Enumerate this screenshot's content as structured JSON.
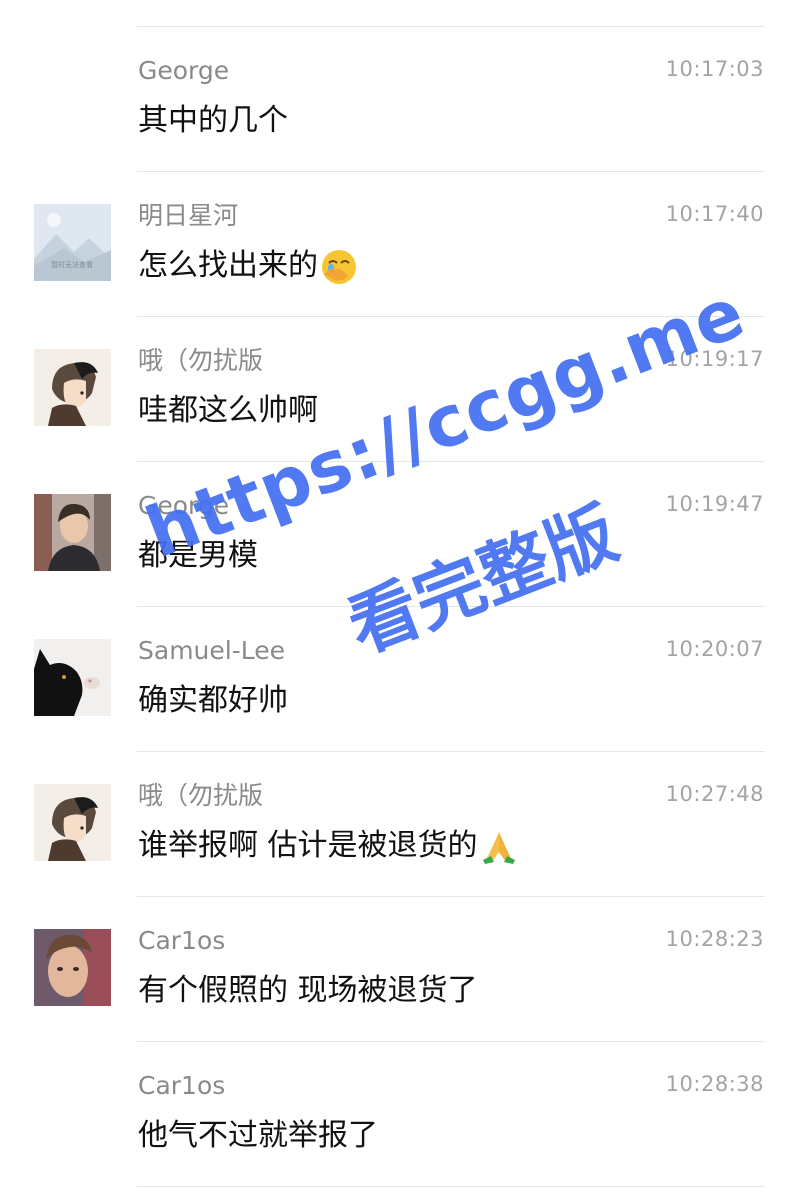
{
  "messages": [
    {
      "sender": "George",
      "time": "10:17:03",
      "text": "其中的几个",
      "avatar": "none",
      "emoji": ""
    },
    {
      "sender": "明日星河",
      "time": "10:17:40",
      "text": "怎么找出来的",
      "avatar": "placeholder-image-icon",
      "emoji": "face-with-hand-over-mouth-emoji"
    },
    {
      "sender": "哦（勿扰版",
      "time": "10:19:17",
      "text": "哇都这么帅啊",
      "avatar": "illustrated-character",
      "emoji": ""
    },
    {
      "sender": "George",
      "time": "10:19:47",
      "text": "都是男模",
      "avatar": "photo-young-man",
      "emoji": ""
    },
    {
      "sender": "Samuel-Lee",
      "time": "10:20:07",
      "text": "确实都好帅",
      "avatar": "black-cat",
      "emoji": ""
    },
    {
      "sender": "哦（勿扰版",
      "time": "10:27:48",
      "text": "谁举报啊 估计是被退货的",
      "avatar": "illustrated-character",
      "emoji": "folded-hands-emoji"
    },
    {
      "sender": "Car1os",
      "time": "10:28:23",
      "text": "有个假照的 现场被退货了",
      "avatar": "photo-man-close-up",
      "emoji": ""
    },
    {
      "sender": "Car1os",
      "time": "10:28:38",
      "text": "他气不过就举报了",
      "avatar": "none",
      "emoji": ""
    }
  ],
  "avatar_placeholder_caption": "暂时无法查看",
  "watermark": {
    "line1": "https://ccgg.me",
    "line2": "看完整版",
    "color": "#426ef0"
  },
  "colors": {
    "sender": "#8a8a8a",
    "time": "#a3a3a3",
    "text": "#111111",
    "divider": "#e6e6e6"
  }
}
